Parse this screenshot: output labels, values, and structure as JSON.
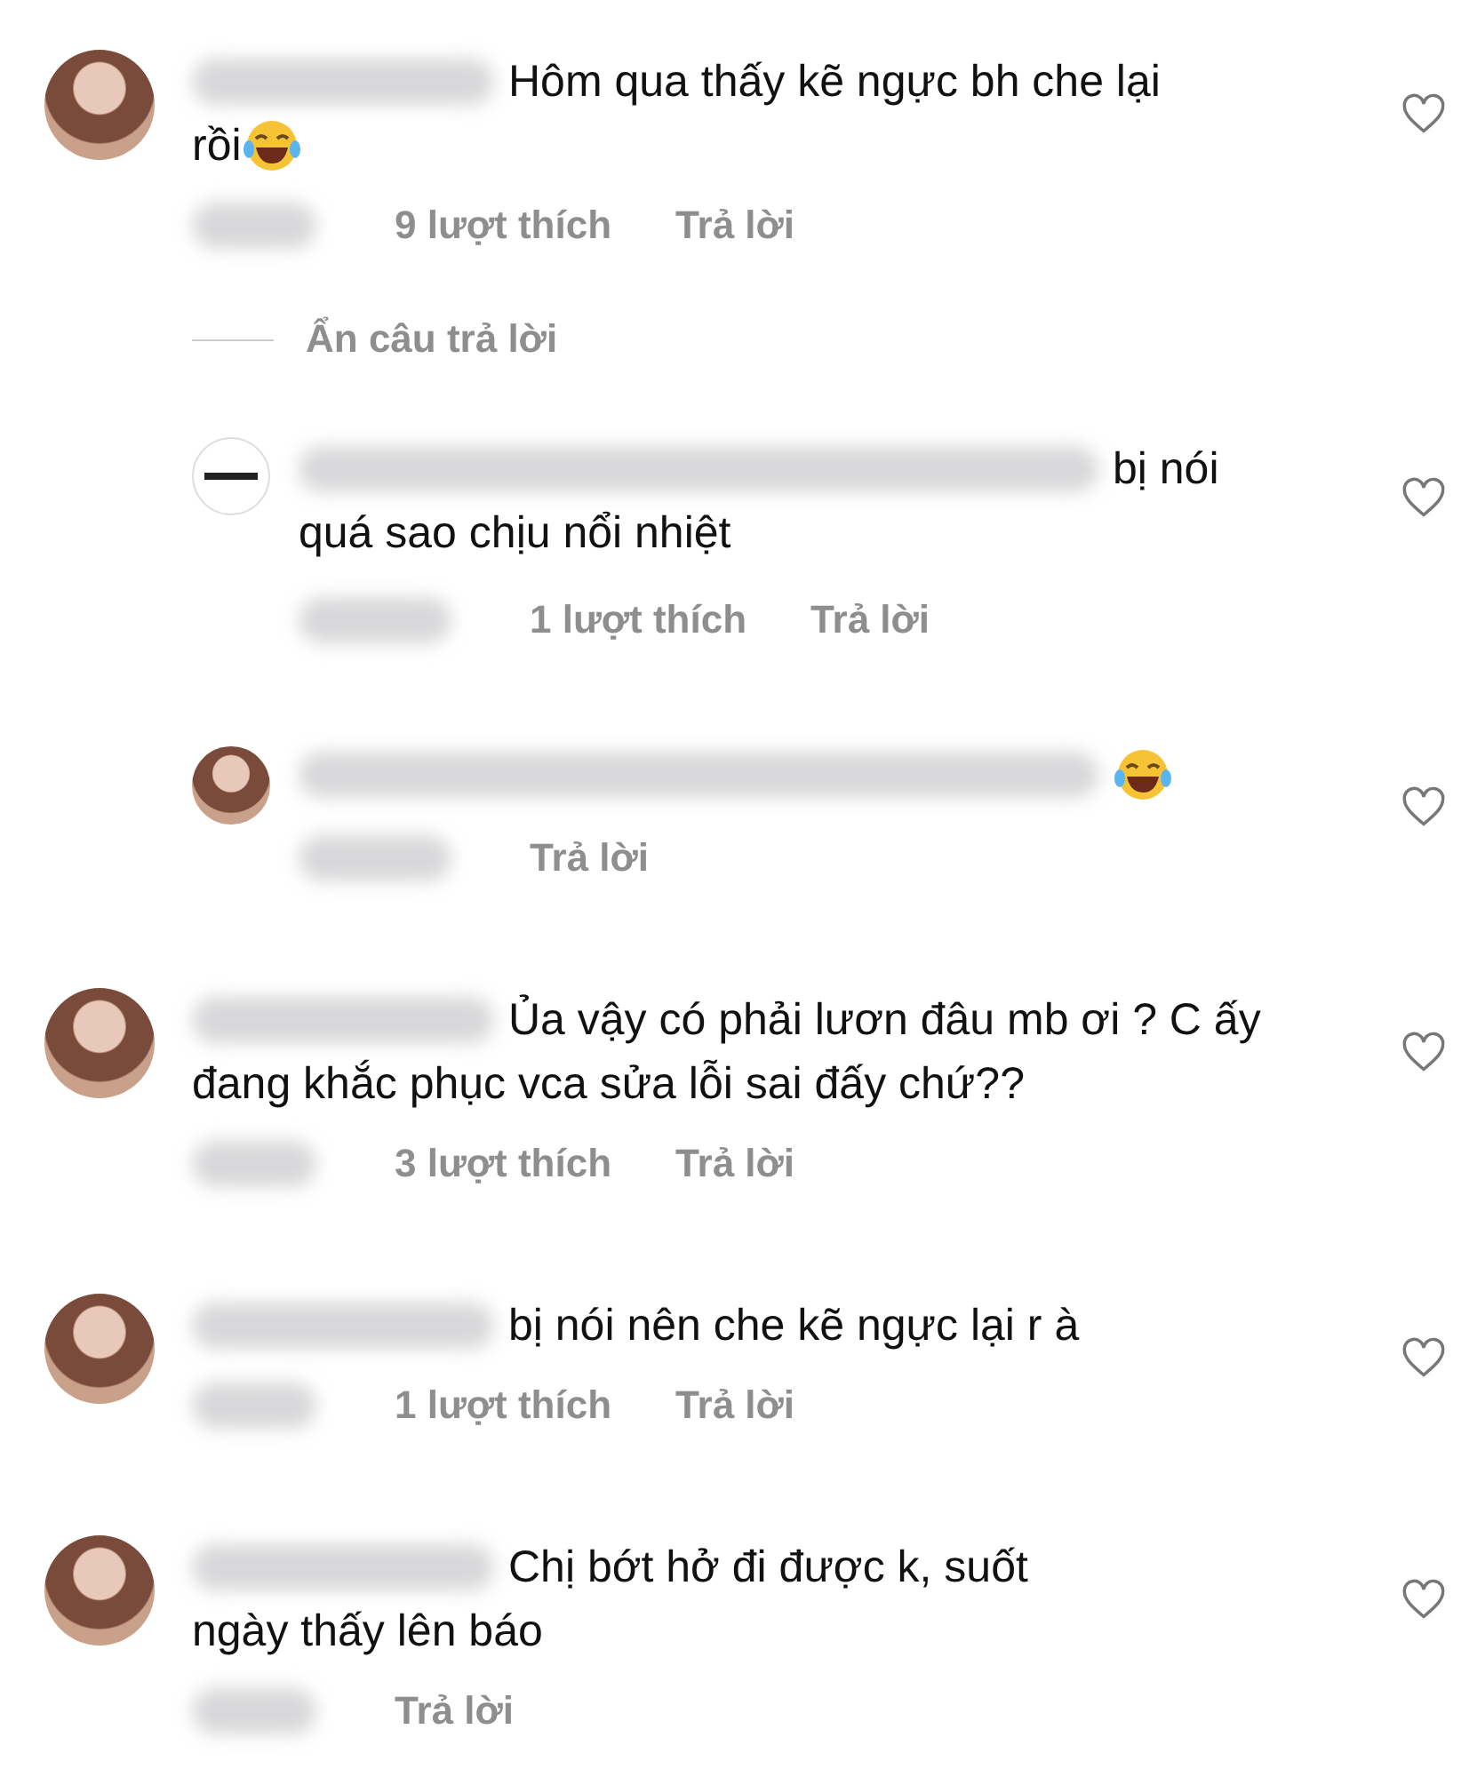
{
  "comments": [
    {
      "lines": [
        "Hôm qua thấy kẽ ngực bh che lại",
        "rồi"
      ],
      "emoji": true,
      "likes": "9 lượt thích",
      "reply_label": "Trả lời",
      "liked": false,
      "hide_replies": "Ẩn câu trả lời",
      "replies": [
        {
          "kind": "logo",
          "lines": [
            "bị nói",
            "quá sao chịu nổi nhiệt"
          ],
          "emoji": false,
          "likes": "1 lượt thích",
          "reply_label": "Trả lời",
          "liked": false
        },
        {
          "kind": "photo",
          "emoji": true,
          "reply_label": "Trả lời",
          "liked": false
        }
      ]
    },
    {
      "lines": [
        "Ủa vậy có phải lươn đâu mb ơi ? C ấy",
        "đang khắc phục vca sửa lỗi sai đấy chứ??"
      ],
      "emoji": false,
      "likes": "3 lượt thích",
      "reply_label": "Trả lời",
      "liked": false
    },
    {
      "lines": [
        "bị nói nên che kẽ ngực lại r à"
      ],
      "emoji": false,
      "likes": "1 lượt thích",
      "reply_label": "Trả lời",
      "liked": false
    },
    {
      "lines": [
        "Chị bớt hở đi được k, suốt",
        "ngày thấy lên báo"
      ],
      "emoji": false,
      "reply_label": "Trả lời",
      "liked": false
    }
  ]
}
